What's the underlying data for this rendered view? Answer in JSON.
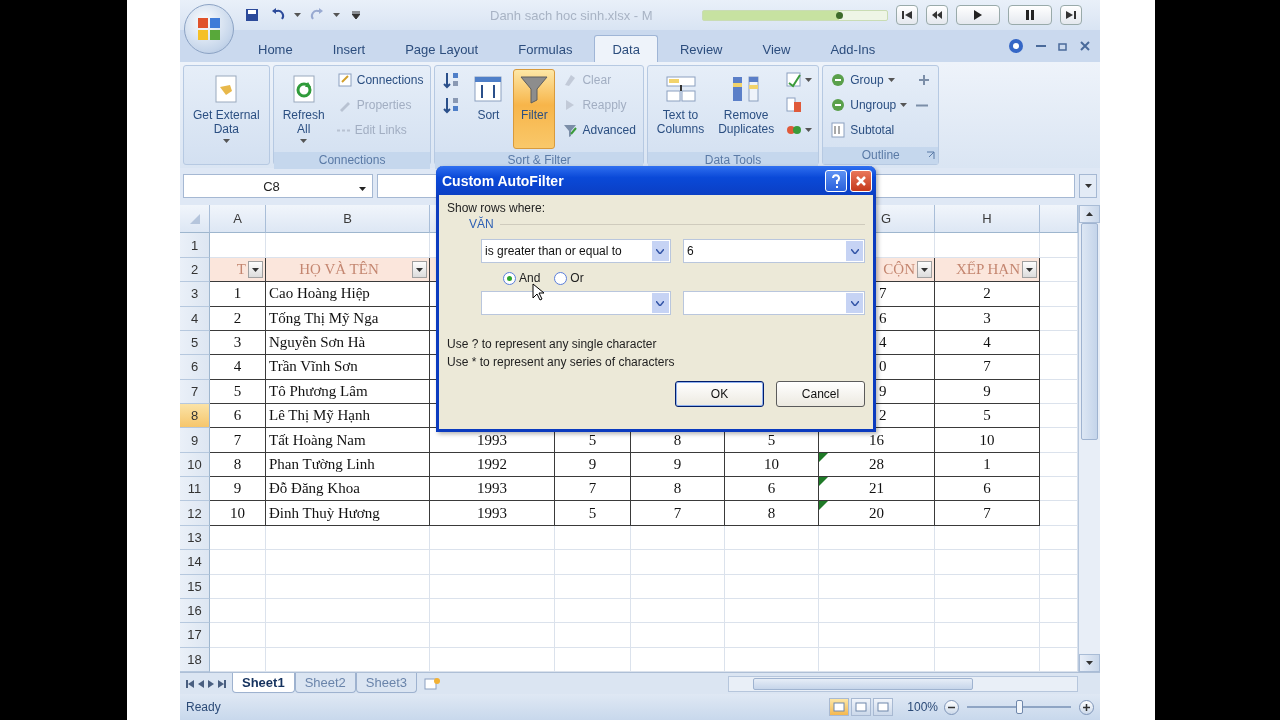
{
  "title": "Danh sach hoc sinh.xlsx - M",
  "player": {
    "level": 0.74
  },
  "tabs": [
    {
      "label": "Home",
      "selected": false
    },
    {
      "label": "Insert",
      "selected": false
    },
    {
      "label": "Page Layout",
      "selected": false
    },
    {
      "label": "Formulas",
      "selected": false
    },
    {
      "label": "Data",
      "selected": true
    },
    {
      "label": "Review",
      "selected": false
    },
    {
      "label": "View",
      "selected": false
    },
    {
      "label": "Add-Ins",
      "selected": false
    }
  ],
  "ribbon": {
    "groups": [
      {
        "columns": [
          [
            {
              "kind": "large",
              "lines": [
                "Get External",
                "Data"
              ],
              "menu": true,
              "on": false,
              "disabled": false
            }
          ]
        ]
      },
      {
        "label": "Connections",
        "columns": [
          [
            {
              "kind": "large",
              "lines": [
                "Refresh",
                "All"
              ],
              "menu": true,
              "on": false,
              "disabled": false
            }
          ],
          [
            {
              "kind": "small",
              "text": "Connections",
              "menu": false,
              "on": false,
              "disabled": false
            },
            {
              "kind": "small",
              "text": "Properties",
              "menu": false,
              "on": false,
              "disabled": true
            },
            {
              "kind": "small",
              "text": "Edit Links",
              "menu": false,
              "on": false,
              "disabled": true
            }
          ]
        ]
      },
      {
        "label": "Sort & Filter",
        "columns": [
          [
            {
              "kind": "icon",
              "menu": false,
              "on": false,
              "disabled": false
            },
            {
              "kind": "icon",
              "menu": false,
              "on": false,
              "disabled": false
            }
          ],
          [
            {
              "kind": "large",
              "lines": [
                "Sort"
              ],
              "menu": false,
              "on": false,
              "disabled": false
            }
          ],
          [
            {
              "kind": "large",
              "lines": [
                "Filter"
              ],
              "menu": false,
              "on": true,
              "disabled": false
            }
          ],
          [
            {
              "kind": "small",
              "text": "Clear",
              "menu": false,
              "on": false,
              "disabled": true
            },
            {
              "kind": "small",
              "text": "Reapply",
              "menu": false,
              "on": false,
              "disabled": true
            },
            {
              "kind": "small",
              "text": "Advanced",
              "menu": false,
              "on": false,
              "disabled": false
            }
          ]
        ]
      },
      {
        "label": "Data Tools",
        "columns": [
          [
            {
              "kind": "large",
              "lines": [
                "Text to",
                "Columns"
              ],
              "menu": false,
              "on": false,
              "disabled": false
            }
          ],
          [
            {
              "kind": "large",
              "lines": [
                "Remove",
                "Duplicates"
              ],
              "menu": false,
              "on": false,
              "disabled": false
            }
          ],
          [
            {
              "kind": "icon",
              "menu": true,
              "on": false,
              "disabled": false
            },
            {
              "kind": "icon",
              "menu": false,
              "on": false,
              "disabled": false
            },
            {
              "kind": "icon",
              "menu": true,
              "on": false,
              "disabled": false
            }
          ]
        ]
      },
      {
        "label": "Outline",
        "launcher": true,
        "columns": [
          [
            {
              "kind": "small",
              "text": "Group",
              "menu": true,
              "on": false,
              "disabled": false
            },
            {
              "kind": "small",
              "text": "Ungroup",
              "menu": true,
              "on": false,
              "disabled": false
            },
            {
              "kind": "small",
              "text": "Subtotal",
              "menu": false,
              "on": false,
              "disabled": false
            }
          ],
          [
            {
              "kind": "icon",
              "menu": false,
              "on": false,
              "disabled": false
            },
            {
              "kind": "icon",
              "menu": false,
              "on": false,
              "disabled": false
            }
          ]
        ]
      }
    ]
  },
  "name_box": "C8",
  "columns": [
    "A",
    "B",
    "G",
    "H"
  ],
  "rows": [
    {
      "number": "1",
      "selected": false
    },
    {
      "number": "2",
      "selected": false,
      "kind": "header",
      "covered": true,
      "cells": [
        "T",
        "HỌ VÀ TÊN",
        "CỘN",
        "XẾP HẠN"
      ]
    },
    {
      "number": "3",
      "selected": false,
      "kind": "data",
      "covered": true,
      "warning": false,
      "cells": [
        "1",
        "Cao Hoàng Hiệp",
        "7",
        "2"
      ]
    },
    {
      "number": "4",
      "selected": false,
      "kind": "data",
      "covered": true,
      "warning": false,
      "cells": [
        "2",
        "Tống Thị Mỹ Nga",
        "6",
        "3"
      ]
    },
    {
      "number": "5",
      "selected": false,
      "kind": "data",
      "covered": true,
      "warning": false,
      "cells": [
        "3",
        "Nguyễn Sơn Hà",
        "4",
        "4"
      ]
    },
    {
      "number": "6",
      "selected": false,
      "kind": "data",
      "covered": true,
      "warning": false,
      "cells": [
        "4",
        "Trần Vĩnh Sơn",
        "0",
        "7"
      ]
    },
    {
      "number": "7",
      "selected": false,
      "kind": "data",
      "covered": true,
      "warning": false,
      "cells": [
        "5",
        "Tô Phương Lâm",
        "9",
        "9"
      ]
    },
    {
      "number": "8",
      "selected": true,
      "kind": "data",
      "covered": true,
      "warning": false,
      "cells": [
        "6",
        "Lê Thị Mỹ Hạnh",
        "2",
        "5"
      ]
    },
    {
      "number": "9",
      "selected": false,
      "kind": "data",
      "covered": false,
      "warning": false,
      "cells": [
        "7",
        "Tất Hoàng Nam",
        "1993",
        "5",
        "8",
        "5",
        "16",
        "10"
      ]
    },
    {
      "number": "10",
      "selected": false,
      "kind": "data",
      "covered": false,
      "warning": true,
      "cells": [
        "8",
        "Phan Tường Linh",
        "1992",
        "9",
        "9",
        "10",
        "28",
        "1"
      ]
    },
    {
      "number": "11",
      "selected": false,
      "kind": "data",
      "covered": false,
      "warning": true,
      "cells": [
        "9",
        "Đỗ Đăng Khoa",
        "1993",
        "7",
        "8",
        "6",
        "21",
        "6"
      ]
    },
    {
      "number": "12",
      "selected": false,
      "kind": "data",
      "covered": false,
      "warning": true,
      "cells": [
        "10",
        "Đinh Thuỳ Hương",
        "1993",
        "5",
        "7",
        "8",
        "20",
        "7"
      ]
    },
    {
      "number": "13",
      "selected": false
    },
    {
      "number": "14",
      "selected": false
    },
    {
      "number": "15",
      "selected": false
    },
    {
      "number": "16",
      "selected": false
    },
    {
      "number": "17",
      "selected": false
    },
    {
      "number": "18",
      "selected": false
    }
  ],
  "dialog": {
    "title": "Custom AutoFilter",
    "prompt": "Show rows where:",
    "field": "VĂN",
    "conditions": [
      {
        "kind": "filled",
        "operator": "is greater than or equal to",
        "value": "6"
      },
      {
        "kind": "blank"
      }
    ],
    "joins": [
      {
        "label": "And",
        "selected": true
      },
      {
        "label": "Or",
        "selected": false
      }
    ],
    "hints": [
      "Use ? to represent any single character",
      "Use * to represent any series of characters"
    ],
    "buttons": [
      {
        "label": "OK",
        "default": true
      },
      {
        "label": "Cancel",
        "default": false
      }
    ]
  },
  "sheets": [
    {
      "label": "Sheet1",
      "selected": true
    },
    {
      "label": "Sheet2",
      "selected": false
    },
    {
      "label": "Sheet3",
      "selected": false
    }
  ],
  "status": {
    "text": "Ready",
    "views": [
      {
        "selected": true
      },
      {
        "selected": false
      },
      {
        "selected": false
      }
    ],
    "zoom": "100%",
    "level": 0.5
  }
}
